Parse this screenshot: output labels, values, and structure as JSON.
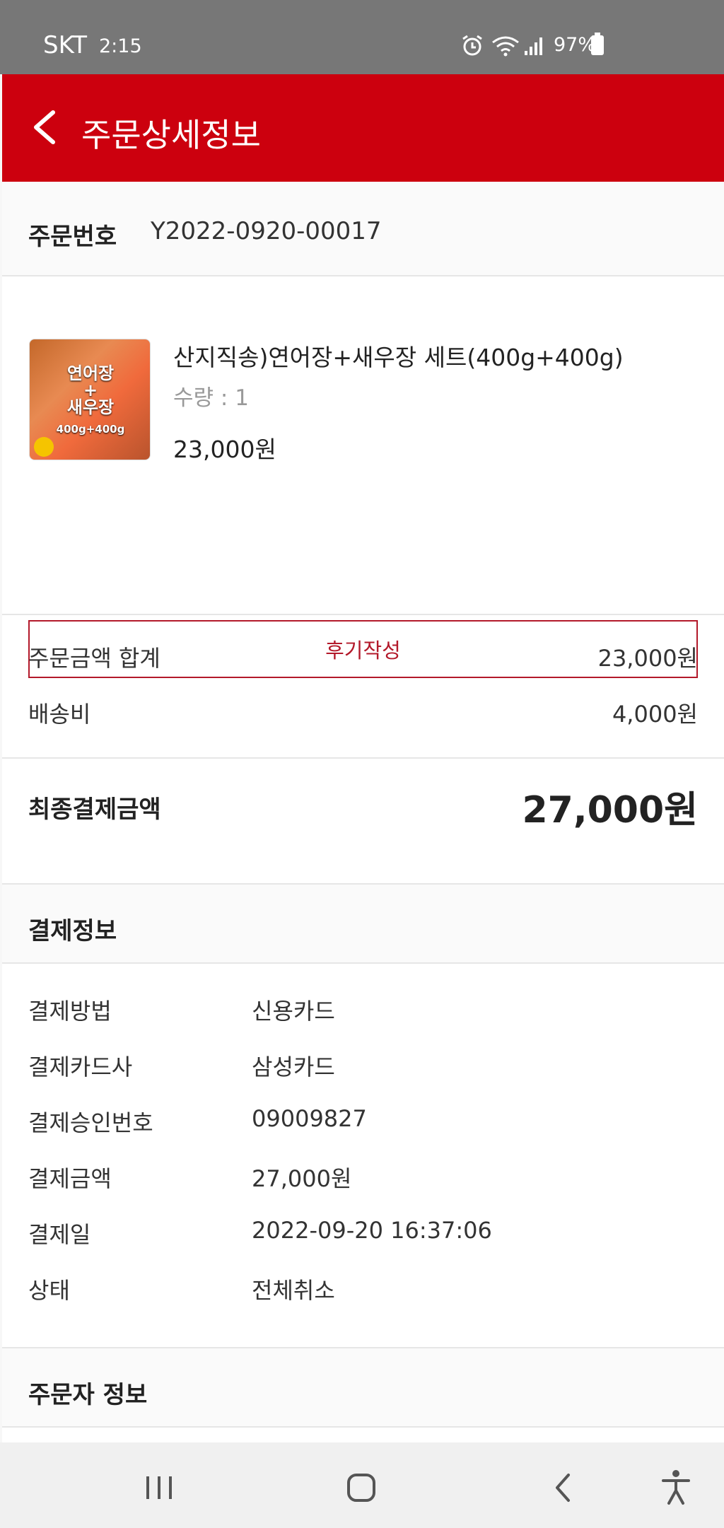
{
  "status_bar": {
    "carrier": "SKT",
    "time": "2:15",
    "battery": "97%",
    "icons": [
      "alarm-icon",
      "wifi-icon",
      "signal-icon",
      "battery-icon"
    ]
  },
  "app_bar": {
    "title": "주문상세정보"
  },
  "order": {
    "number_label": "주문번호",
    "number_value": "Y2022-0920-00017"
  },
  "product": {
    "name": "산지직송)연어장+새우장 세트(400g+400g)",
    "quantity": "수량 : 1",
    "price": "23,000원",
    "thumbnail_text_1": "연어장\n+\n새우장",
    "thumbnail_text_2": "400g+400g",
    "review_button": "후기작성"
  },
  "amounts": {
    "order_total_label": "주문금액 합계",
    "order_total_value": "23,000원",
    "shipping_label": "배송비",
    "shipping_value": "4,000원"
  },
  "final": {
    "label": "최종결제금액",
    "value": "27,000원"
  },
  "payment_info": {
    "title": "결제정보",
    "rows": [
      {
        "key": "결제방법",
        "value": "신용카드"
      },
      {
        "key": "결제카드사",
        "value": "삼성카드"
      },
      {
        "key": "결제승인번호",
        "value": "09009827"
      },
      {
        "key": "결제금액",
        "value": "27,000원"
      },
      {
        "key": "결제일",
        "value": "2022-09-20 16:37:06"
      },
      {
        "key": "상태",
        "value": "전체취소"
      }
    ]
  },
  "orderer_info": {
    "title": "주문자 정보"
  },
  "colors": {
    "brand_red": "#cc000e",
    "status_bar": "#777777",
    "button_border": "#b3192a"
  }
}
